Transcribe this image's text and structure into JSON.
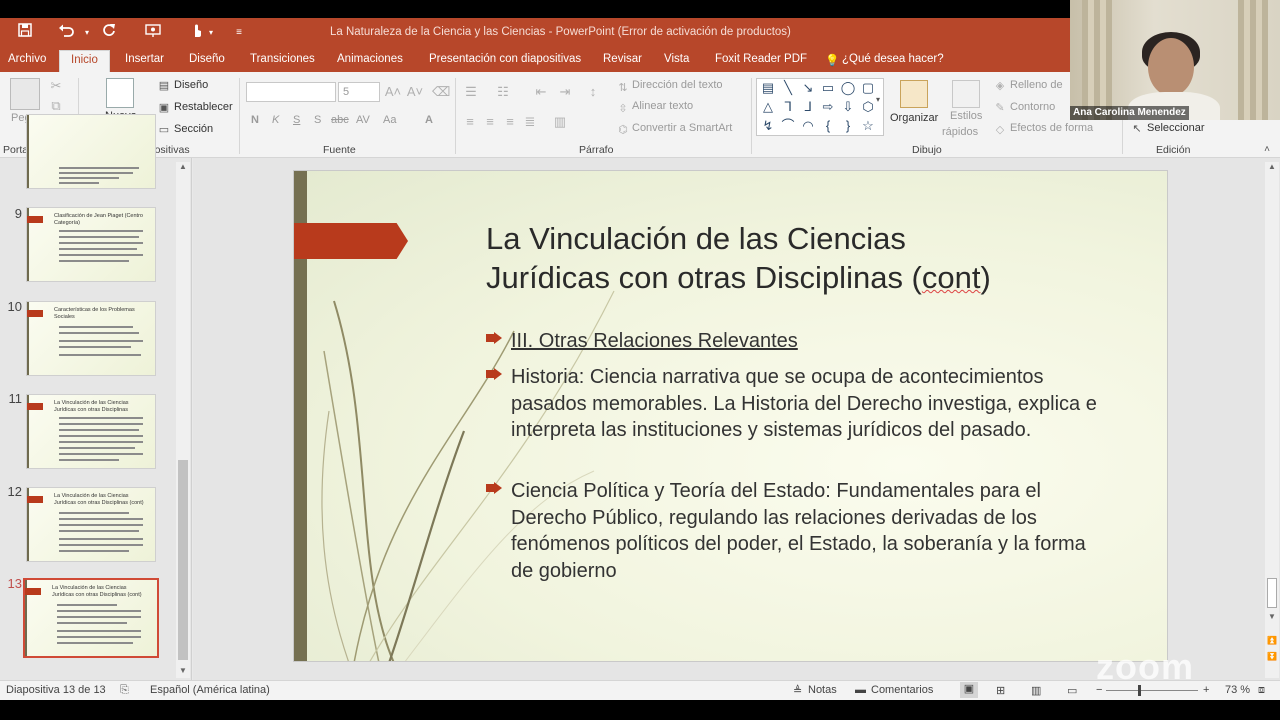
{
  "window": {
    "title": "La Naturaleza de la Ciencia y las Ciencias - PowerPoint (Error de activación de productos)",
    "accent": "#b7472a"
  },
  "qat": {
    "save_icon": "save-icon",
    "undo_icon": "undo-icon",
    "redo_icon": "repeat-icon",
    "present_icon": "present-from-start-icon",
    "touch_icon": "touch-mode-icon",
    "customize_icon": "customize-qat-icon"
  },
  "tabs": [
    {
      "label": "Archivo"
    },
    {
      "label": "Inicio"
    },
    {
      "label": "Insertar"
    },
    {
      "label": "Diseño"
    },
    {
      "label": "Transiciones"
    },
    {
      "label": "Animaciones"
    },
    {
      "label": "Presentación con diapositivas"
    },
    {
      "label": "Revisar"
    },
    {
      "label": "Vista"
    },
    {
      "label": "Foxit Reader PDF"
    },
    {
      "label": "¿Qué desea hacer?"
    }
  ],
  "ribbon": {
    "clipboard": {
      "label": "Portapapeles",
      "paste": "Pegar"
    },
    "slides": {
      "label": "Diapositivas",
      "new_slide_line1": "Nueva",
      "new_slide_line2": "diapositiva",
      "layout": "Diseño",
      "reset": "Restablecer",
      "section": "Sección"
    },
    "font": {
      "label": "Fuente",
      "size": "5",
      "bold": "N",
      "italic": "K",
      "underline": "S",
      "shadow": "S",
      "strike": "abc",
      "spacing": "AV",
      "case": "Aa",
      "color": "A"
    },
    "paragraph": {
      "label": "Párrafo",
      "text_direction": "Dirección del texto",
      "align_text": "Alinear texto",
      "smartart": "Convertir a SmartArt"
    },
    "drawing": {
      "label": "Dibujo",
      "arrange": "Organizar",
      "quick_styles_1": "Estilos",
      "quick_styles_2": "rápidos",
      "fill": "Relleno de",
      "outline": "Contorno",
      "effects": "Efectos de forma"
    },
    "editing": {
      "label": "Edición",
      "select": "Seleccionar"
    }
  },
  "webcam": {
    "name": "Ana Carolina Menendez"
  },
  "thumbnails": [
    {
      "num": "9",
      "title": "Clasificación de Jean Piaget (Centro Categoría)"
    },
    {
      "num": "10",
      "title": "Características de los Problemas Sociales"
    },
    {
      "num": "11",
      "title": "La Vinculación de las Ciencias Jurídicas con otras Disciplinas"
    },
    {
      "num": "12",
      "title": "La Vinculación de las Ciencias Jurídicas con otras Disciplinas (cont)"
    },
    {
      "num": "13",
      "title": "La Vinculación de las Ciencias Jurídicas con otras Disciplinas (cont)"
    }
  ],
  "slide": {
    "title_line1": "La Vinculación de las Ciencias",
    "title_line2_pre": "Jurídicas con otras Disciplinas (",
    "title_line2_word": "cont",
    "title_line2_post": ")",
    "bullets": [
      {
        "text": "III. Otras Relaciones Relevantes",
        "underlined": true
      },
      {
        "text": " Historia: Ciencia narrativa que se ocupa de acontecimientos pasados memorables. La Historia del Derecho investiga, explica e interpreta las instituciones y sistemas jurídicos del pasado.",
        "underlined": false
      },
      {
        "text": "Ciencia Política y Teoría del Estado: Fundamentales para el Derecho Público, regulando las relaciones derivadas de los fenómenos políticos del poder, el Estado, la soberanía y la forma de gobierno",
        "underlined": false
      }
    ],
    "accent": "#b83a1c"
  },
  "watermark": "zoom",
  "status": {
    "slide_info": "Diapositiva 13 de 13",
    "language": "Español (América latina)",
    "notes": "Notas",
    "comments": "Comentarios",
    "zoom": "73 %"
  }
}
